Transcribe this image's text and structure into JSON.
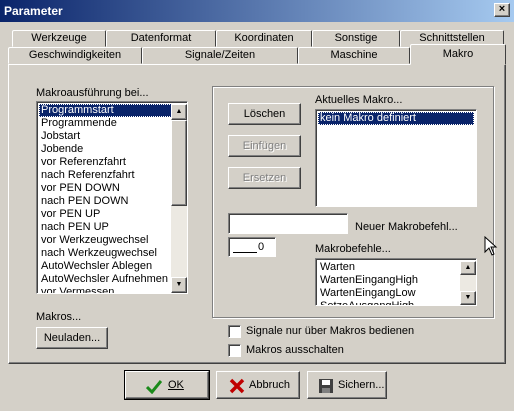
{
  "window": {
    "title": "Parameter",
    "close_glyph": "×"
  },
  "tabs_row1": [
    "Werkzeuge",
    "Datenformat",
    "Koordinaten",
    "Sonstige",
    "Schnittstellen"
  ],
  "tabs_row2": [
    "Geschwindigkeiten",
    "Signale/Zeiten",
    "Maschine",
    "Makro"
  ],
  "active_tab": "Makro",
  "left": {
    "label": "Makroausführung bei...",
    "events": [
      "Programmstart",
      "Programmende",
      "Jobstart",
      "Jobende",
      "vor Referenzfahrt",
      "nach Referenzfahrt",
      "vor PEN DOWN",
      "nach PEN DOWN",
      "vor PEN UP",
      "nach PEN UP",
      "vor Werkzeugwechsel",
      "nach Werkzeugwechsel",
      "AutoWechsler Ablegen",
      "AutoWechsler Aufnehmen",
      "vor Vermessen"
    ],
    "selected_index": 0,
    "makros_label": "Makros...",
    "reload_button": "Neuladen..."
  },
  "right": {
    "delete_button": "Löschen",
    "insert_button": "Einfügen",
    "replace_button": "Ersetzen",
    "current_macro_label": "Aktuelles Makro...",
    "current_macro_items": [
      "kein Makro definiert"
    ],
    "new_command_label": "Neuer Makrobefehl...",
    "new_command_value": "",
    "param_value": "0",
    "commands_label": "Makrobefehle...",
    "commands": [
      "Warten",
      "WartenEingangHigh",
      "WartenEingangLow",
      "SetzeAusgangHigh"
    ]
  },
  "options": {
    "signals_only_macros": {
      "label": "Signale nur über Makros bedienen",
      "checked": false
    },
    "disable_macros": {
      "label": "Makros ausschalten",
      "checked": false
    }
  },
  "buttons": {
    "ok": "OK",
    "cancel": "Abbruch",
    "save": "Sichern..."
  },
  "icons": {
    "ok": "checkmark-icon",
    "cancel": "red-x-icon",
    "save": "floppy-disk-icon"
  },
  "colors": {
    "selection": "#0a246a",
    "title_start": "#0a246a",
    "title_end": "#a6caf0",
    "ok_icon": "#1a8a1a",
    "cancel_icon": "#c00000"
  }
}
